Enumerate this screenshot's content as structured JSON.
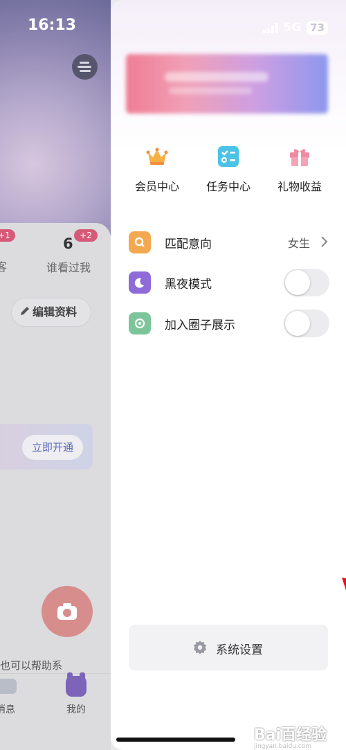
{
  "status_bar": {
    "time": "16:13",
    "network": "5G",
    "battery": "73"
  },
  "background_profile": {
    "stats": [
      {
        "count": "",
        "badge": "+1",
        "label": "客"
      },
      {
        "count": "6",
        "badge": "+2",
        "label": "谁看过我"
      }
    ],
    "edit_profile_label": "编辑资料",
    "vip_button_label": "立即开通",
    "help_text": "也可以帮助系",
    "tabs": [
      {
        "label": "消息",
        "icon": "message-icon"
      },
      {
        "label": "我的",
        "icon": "mine-icon"
      }
    ]
  },
  "drawer": {
    "quick_actions": [
      {
        "label": "会员中心",
        "icon": "crown-icon"
      },
      {
        "label": "任务中心",
        "icon": "task-list-icon"
      },
      {
        "label": "礼物收益",
        "icon": "gift-icon"
      }
    ],
    "settings_rows": [
      {
        "label": "匹配意向",
        "value": "女生",
        "icon": "search-icon",
        "color": "#f4a950"
      },
      {
        "label": "黑夜模式",
        "toggle": false,
        "icon": "moon-icon",
        "color": "#8f6ad9"
      },
      {
        "label": "加入圈子展示",
        "toggle": false,
        "icon": "circle-dot-icon",
        "color": "#7cc59a"
      }
    ],
    "system_settings_label": "系统设置"
  },
  "watermark": {
    "text": "Bai百经验",
    "sub": "jingyan.baidu.com"
  },
  "colors": {
    "accent_badge": "#d65a78",
    "vip_text": "#5b67b9",
    "annotation_arrow": "#e8141b"
  }
}
